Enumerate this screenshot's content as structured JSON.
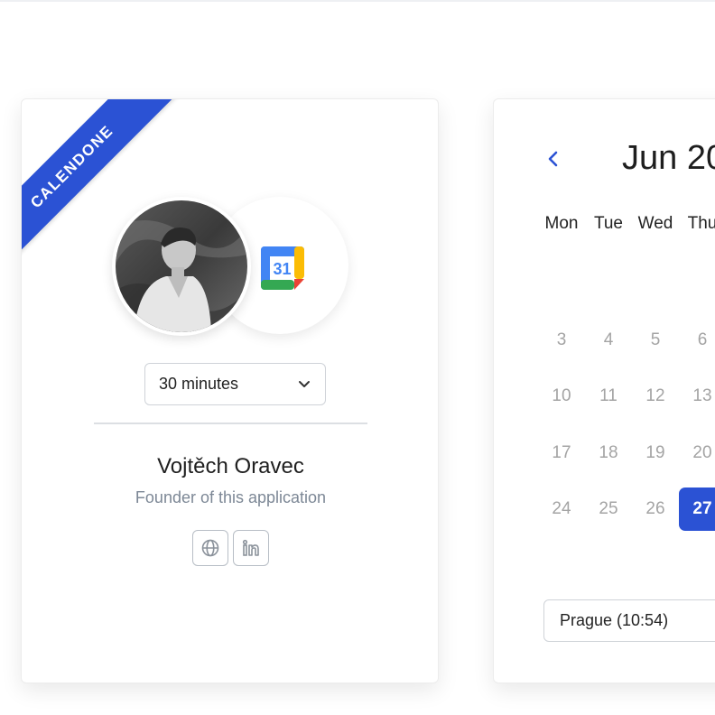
{
  "brand": {
    "ribbon_text": "CALENDONE",
    "accent_color": "#2b52d4"
  },
  "profile": {
    "avatar": "profile-photo",
    "calendar_icon": "google-calendar-icon",
    "calendar_icon_number": "31",
    "duration": {
      "selected": "30 minutes",
      "icon": "chevron-down-icon"
    },
    "name": "Vojtěch Oravec",
    "role": "Founder of this application",
    "links": [
      {
        "icon": "globe-icon"
      },
      {
        "icon": "linkedin-icon"
      }
    ]
  },
  "calendar": {
    "prev_icon": "chevron-left-icon",
    "month_label": "Jun 20",
    "weekdays": [
      "Mon",
      "Tue",
      "Wed",
      "Thu"
    ],
    "rows": [
      [
        "3",
        "4",
        "5",
        "6"
      ],
      [
        "10",
        "11",
        "12",
        "13"
      ],
      [
        "17",
        "18",
        "19",
        "20"
      ],
      [
        "24",
        "25",
        "26",
        "27"
      ]
    ],
    "selected_day": "27",
    "timezone": "Prague (10:54)"
  }
}
